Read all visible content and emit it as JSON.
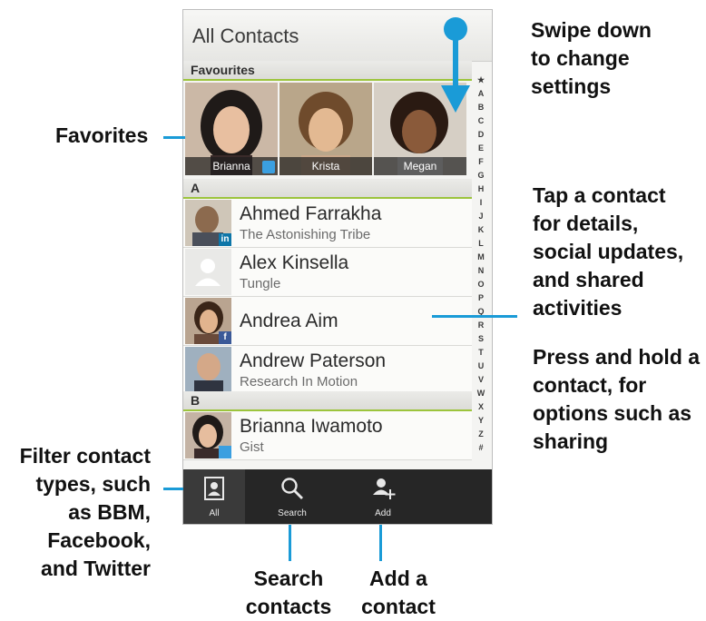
{
  "callouts": {
    "swipe": "Swipe down\nto change\nsettings",
    "favorites": "Favorites",
    "tap": "Tap a contact\nfor details,\nsocial updates,\nand shared\nactivities",
    "press": "Press and hold a\ncontact, for\noptions such as\nsharing",
    "filter": "Filter contact\ntypes, such\nas BBM,\nFacebook,\nand Twitter",
    "search": "Search\ncontacts",
    "add": "Add a\ncontact"
  },
  "header": {
    "title": "All Contacts"
  },
  "sections": {
    "favourites": "Favourites",
    "a": "A",
    "b": "B"
  },
  "favourites": [
    {
      "name": "Brianna",
      "badge": "twitter-icon"
    },
    {
      "name": "Krista"
    },
    {
      "name": "Megan"
    }
  ],
  "contacts": [
    {
      "name": "Ahmed Farrakha",
      "sub": "The Astonishing Tribe",
      "badge": "in"
    },
    {
      "name": "Alex Kinsella",
      "sub": "Tungle",
      "badge": ""
    },
    {
      "name": "Andrea Aim",
      "sub": "",
      "badge": "f"
    },
    {
      "name": "Andrew Paterson",
      "sub": "Research In Motion",
      "badge": ""
    },
    {
      "name": "Brianna Iwamoto",
      "sub": "Gist",
      "badge": "twitter-icon"
    }
  ],
  "index_letters": [
    "★",
    "A",
    "B",
    "C",
    "D",
    "E",
    "F",
    "G",
    "H",
    "I",
    "J",
    "K",
    "L",
    "M",
    "N",
    "O",
    "P",
    "Q",
    "R",
    "S",
    "T",
    "U",
    "V",
    "W",
    "X",
    "Y",
    "Z",
    "#"
  ],
  "toolbar": {
    "all": "All",
    "search": "Search",
    "add": "Add"
  },
  "colors": {
    "accent": "#1a9bd7",
    "section_underline": "#9cc43c",
    "toolbar_bg": "#262626"
  }
}
